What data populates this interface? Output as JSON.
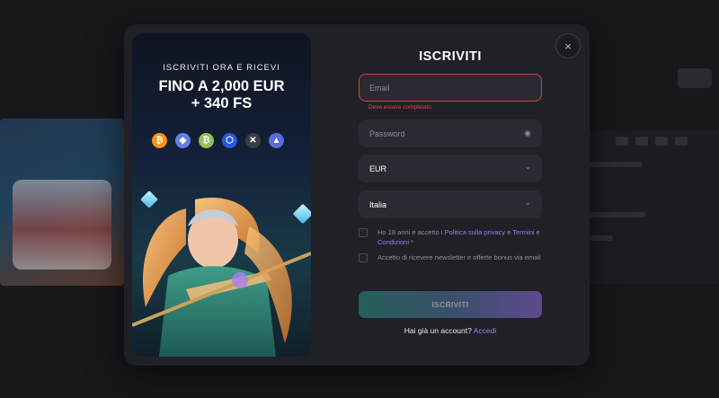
{
  "modal": {
    "close_label": "×"
  },
  "promo": {
    "subtitle": "ISCRIVITI ORA E RICEVI",
    "title_line1": "FINO A 2,000 EUR",
    "title_line2": "+ 340 FS",
    "coins": [
      {
        "icon": "bitcoin-icon",
        "glyph": "₿",
        "color": "#f7931a"
      },
      {
        "icon": "ethereum-icon",
        "glyph": "◆",
        "color": "#627eea"
      },
      {
        "icon": "bitcoin-cash-icon",
        "glyph": "₿",
        "color": "#8dc351"
      },
      {
        "icon": "chainlink-icon",
        "glyph": "⬡",
        "color": "#2a5ada"
      },
      {
        "icon": "xrp-icon",
        "glyph": "✕",
        "color": "#3b3c44"
      },
      {
        "icon": "tron-icon",
        "glyph": "▲",
        "color": "#5a6bdc"
      }
    ]
  },
  "form": {
    "title": "ISCRIVITI",
    "email_placeholder": "Email",
    "email_error": "Deve essere completato",
    "password_placeholder": "Password",
    "currency_value": "EUR",
    "country_value": "Italia",
    "terms_prefix": "Ho 18 anni e accetto i ",
    "privacy_link": "Politica sulla privacy",
    "terms_and": " e ",
    "terms_link": "Termini e Condizioni",
    "terms_star": " *",
    "newsletter_label": "Accetto di ricevere newsletter e offerte bonus via email",
    "submit_label": "ISCRIVITI",
    "login_prompt": "Hai già un account? ",
    "login_link": "Accedi"
  },
  "colors": {
    "accent_link": "#9b7bf0",
    "error": "#e0453f",
    "modal_bg": "#202127"
  }
}
